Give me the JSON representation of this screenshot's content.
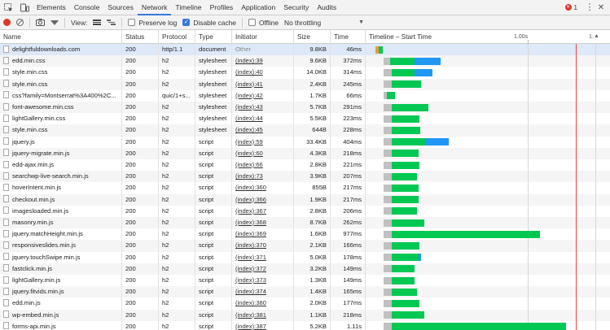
{
  "tabs": [
    "Elements",
    "Console",
    "Sources",
    "Network",
    "Timeline",
    "Profiles",
    "Application",
    "Security",
    "Audits"
  ],
  "active_tab": "Network",
  "error_count": "1",
  "toolbar": {
    "view_label": "View:",
    "preserve_log": "Preserve log",
    "disable_cache": "Disable cache",
    "offline": "Offline",
    "throttling": "No throttling"
  },
  "columns": {
    "name": "Name",
    "status": "Status",
    "protocol": "Protocol",
    "type": "Type",
    "initiator": "Initiator",
    "size": "Size",
    "time": "Time",
    "timeline": "Timeline – Start Time",
    "tick1": "1.00s",
    "tick2": "1."
  },
  "colors": {
    "waiting": "#00c853",
    "download": "#2196f3",
    "stalled": "#c0c0c0",
    "load_line": "#e84848",
    "selected_row": "#dde8f8",
    "tab_underline": "#3879d9"
  },
  "rows": [
    {
      "name": "delightfuldownloads.com",
      "status": "200",
      "protocol": "http/1.1",
      "type": "document",
      "initiator": "Other",
      "size": "9.8KB",
      "time": "46ms"
    },
    {
      "name": "edd.min.css",
      "status": "200",
      "protocol": "h2",
      "type": "stylesheet",
      "initiator": "(index):39",
      "size": "9.6KB",
      "time": "372ms"
    },
    {
      "name": "style.min.css",
      "status": "200",
      "protocol": "h2",
      "type": "stylesheet",
      "initiator": "(index):40",
      "size": "14.0KB",
      "time": "314ms"
    },
    {
      "name": "style.min.css",
      "status": "200",
      "protocol": "h2",
      "type": "stylesheet",
      "initiator": "(index):41",
      "size": "2.4KB",
      "time": "245ms"
    },
    {
      "name": "css?family=Montserrat%3A400%2C...",
      "status": "200",
      "protocol": "quic/1+s...",
      "type": "stylesheet",
      "initiator": "(index):42",
      "size": "1.7KB",
      "time": "66ms"
    },
    {
      "name": "font-awesome.min.css",
      "status": "200",
      "protocol": "h2",
      "type": "stylesheet",
      "initiator": "(index):43",
      "size": "5.7KB",
      "time": "291ms"
    },
    {
      "name": "lightGallery.min.css",
      "status": "200",
      "protocol": "h2",
      "type": "stylesheet",
      "initiator": "(index):44",
      "size": "5.5KB",
      "time": "223ms"
    },
    {
      "name": "style.min.css",
      "status": "200",
      "protocol": "h2",
      "type": "stylesheet",
      "initiator": "(index):45",
      "size": "644B",
      "time": "228ms"
    },
    {
      "name": "jquery.js",
      "status": "200",
      "protocol": "h2",
      "type": "script",
      "initiator": "(index):59",
      "size": "33.4KB",
      "time": "404ms"
    },
    {
      "name": "jquery-migrate.min.js",
      "status": "200",
      "protocol": "h2",
      "type": "script",
      "initiator": "(index):60",
      "size": "4.3KB",
      "time": "218ms"
    },
    {
      "name": "edd-ajax.min.js",
      "status": "200",
      "protocol": "h2",
      "type": "script",
      "initiator": "(index):66",
      "size": "2.8KB",
      "time": "221ms"
    },
    {
      "name": "searchwp-live-search.min.js",
      "status": "200",
      "protocol": "h2",
      "type": "script",
      "initiator": "(index):73",
      "size": "3.9KB",
      "time": "207ms"
    },
    {
      "name": "hoverIntent.min.js",
      "status": "200",
      "protocol": "h2",
      "type": "script",
      "initiator": "(index):360",
      "size": "855B",
      "time": "217ms"
    },
    {
      "name": "checkout.min.js",
      "status": "200",
      "protocol": "h2",
      "type": "script",
      "initiator": "(index):366",
      "size": "1.9KB",
      "time": "217ms"
    },
    {
      "name": "imagesloaded.min.js",
      "status": "200",
      "protocol": "h2",
      "type": "script",
      "initiator": "(index):367",
      "size": "2.8KB",
      "time": "206ms"
    },
    {
      "name": "masonry.min.js",
      "status": "200",
      "protocol": "h2",
      "type": "script",
      "initiator": "(index):368",
      "size": "8.7KB",
      "time": "262ms"
    },
    {
      "name": "jquery.matchHeight.min.js",
      "status": "200",
      "protocol": "h2",
      "type": "script",
      "initiator": "(index):369",
      "size": "1.6KB",
      "time": "977ms"
    },
    {
      "name": "responsiveslides.min.js",
      "status": "200",
      "protocol": "h2",
      "type": "script",
      "initiator": "(index):370",
      "size": "2.1KB",
      "time": "166ms"
    },
    {
      "name": "jquery.touchSwipe.min.js",
      "status": "200",
      "protocol": "h2",
      "type": "script",
      "initiator": "(index):371",
      "size": "5.0KB",
      "time": "178ms"
    },
    {
      "name": "fastclick.min.js",
      "status": "200",
      "protocol": "h2",
      "type": "script",
      "initiator": "(index):372",
      "size": "3.2KB",
      "time": "149ms"
    },
    {
      "name": "lightGallery.min.js",
      "status": "200",
      "protocol": "h2",
      "type": "script",
      "initiator": "(index):373",
      "size": "1.3KB",
      "time": "149ms"
    },
    {
      "name": "jquery.fitvids.min.js",
      "status": "200",
      "protocol": "h2",
      "type": "script",
      "initiator": "(index):374",
      "size": "1.4KB",
      "time": "165ms"
    },
    {
      "name": "edd.min.js",
      "status": "200",
      "protocol": "h2",
      "type": "script",
      "initiator": "(index):380",
      "size": "2.0KB",
      "time": "177ms"
    },
    {
      "name": "wp-embed.min.js",
      "status": "200",
      "protocol": "h2",
      "type": "script",
      "initiator": "(index):381",
      "size": "1.1KB",
      "time": "218ms"
    },
    {
      "name": "forms-api.min.js",
      "status": "200",
      "protocol": "h2",
      "type": "script",
      "initiator": "(index):387",
      "size": "5.2KB",
      "time": "1.11s"
    }
  ]
}
